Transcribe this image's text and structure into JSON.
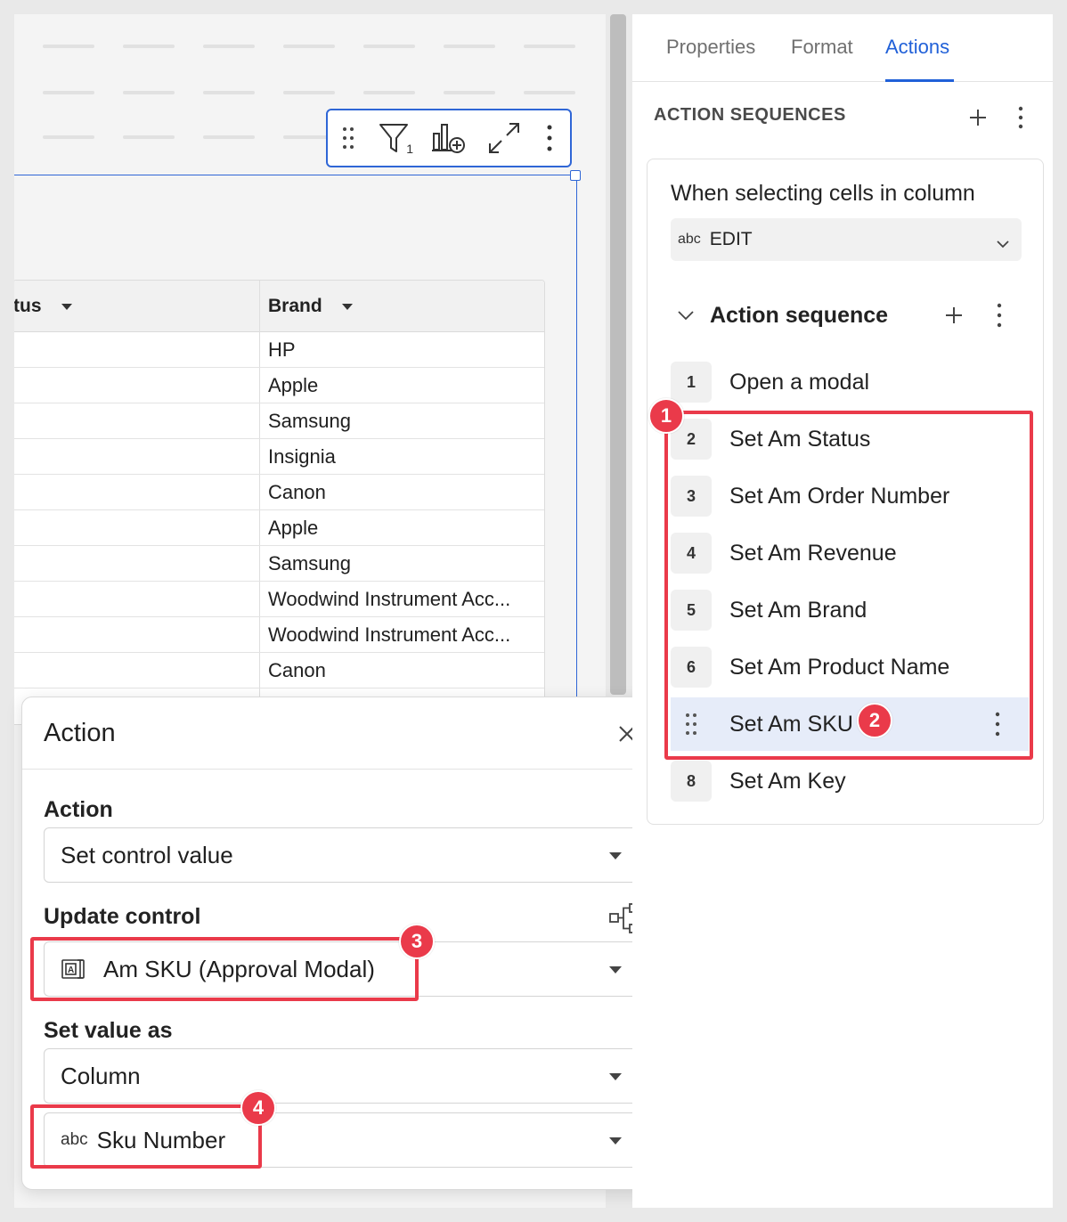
{
  "canvas": {
    "table": {
      "columns": [
        "tus",
        "Brand"
      ],
      "rows": [
        "HP",
        "Apple",
        "Samsung",
        "Insignia",
        "Canon",
        "Apple",
        "Samsung",
        "Woodwind Instrument Acc...",
        "Woodwind Instrument Acc...",
        "Canon"
      ]
    },
    "toolbar": {
      "filter_count": "1"
    }
  },
  "panel": {
    "tabs": [
      "Properties",
      "Format",
      "Actions"
    ],
    "active_tab": "Actions",
    "section_title": "ACTION SEQUENCES",
    "trigger_label": "When selecting cells in column",
    "trigger_column_type": "abc",
    "trigger_column": "EDIT",
    "sequence_title": "Action sequence",
    "steps": [
      {
        "num": "1",
        "label": "Open a modal"
      },
      {
        "num": "2",
        "label": "Set Am Status"
      },
      {
        "num": "3",
        "label": "Set Am Order Number"
      },
      {
        "num": "4",
        "label": "Set Am Revenue"
      },
      {
        "num": "5",
        "label": "Set Am Brand"
      },
      {
        "num": "6",
        "label": "Set Am Product Name"
      },
      {
        "num": "",
        "label": "Set Am SKU"
      },
      {
        "num": "8",
        "label": "Set Am Key"
      }
    ]
  },
  "popover": {
    "title": "Action",
    "action_label": "Action",
    "action_value": "Set control value",
    "update_label": "Update control",
    "update_value": "Am SKU (Approval Modal)",
    "setvalue_label": "Set value as",
    "setvalue_value": "Column",
    "column_type": "abc",
    "column_value": "Sku Number"
  },
  "annotations": [
    "1",
    "2",
    "3",
    "4"
  ],
  "colors": {
    "accent": "#2060d8",
    "annotation": "#ea3a4a",
    "selected_row": "#e6ecf9"
  }
}
